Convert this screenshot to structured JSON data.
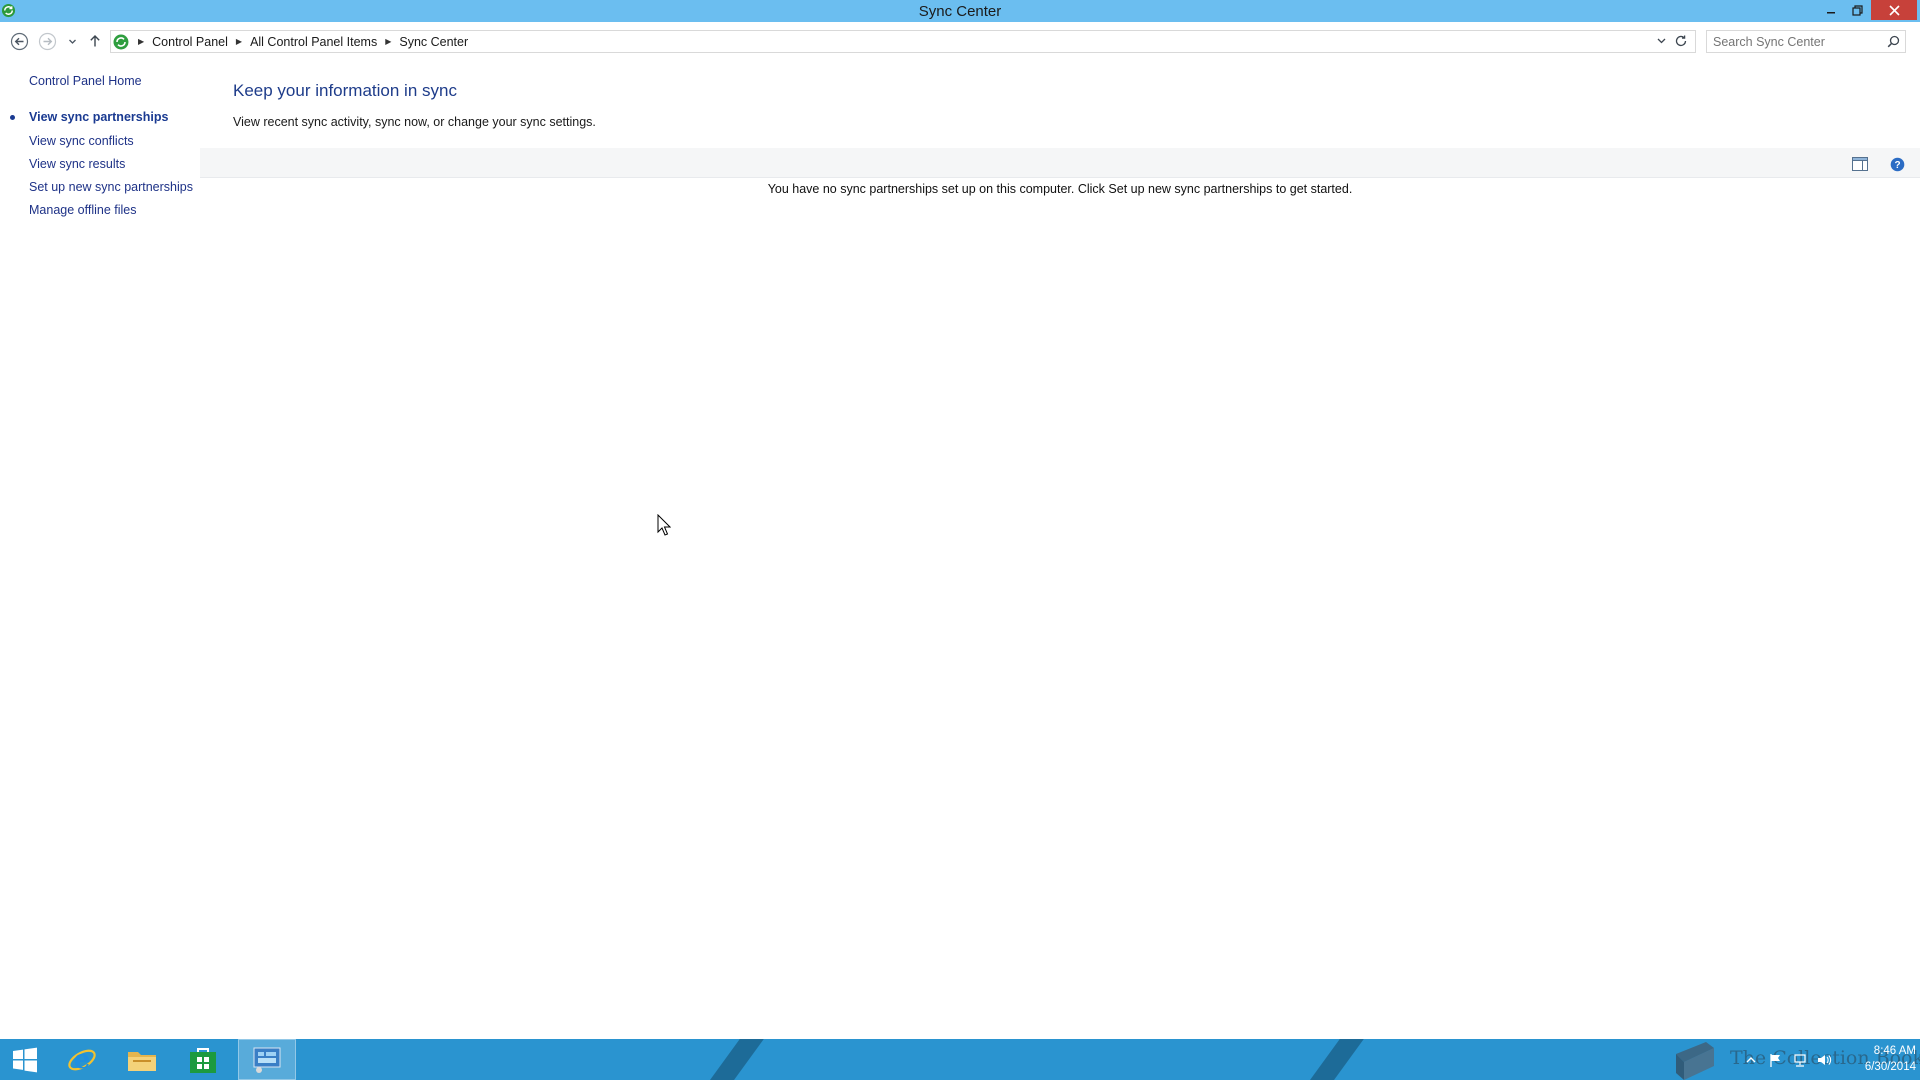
{
  "window": {
    "title": "Sync Center"
  },
  "address_bar": {
    "breadcrumbs": [
      "Control Panel",
      "All Control Panel Items",
      "Sync Center"
    ]
  },
  "search": {
    "placeholder": "Search Sync Center"
  },
  "left_pane": {
    "home": "Control Panel Home",
    "items": [
      {
        "label": "View sync partnerships",
        "selected": true
      },
      {
        "label": "View sync conflicts",
        "selected": false
      },
      {
        "label": "View sync results",
        "selected": false
      },
      {
        "label": "Set up new sync partnerships",
        "selected": false
      },
      {
        "label": "Manage offline files",
        "selected": false
      }
    ]
  },
  "main": {
    "title": "Keep your information in sync",
    "description": "View recent sync activity, sync now, or change your sync settings.",
    "empty_message": "You have no sync partnerships set up on this computer. Click Set up new sync partnerships to get started."
  },
  "taskbar": {
    "time": "8:46 AM",
    "date": "6/30/2014",
    "watermark": "The Collection Book",
    "icons": [
      "windows-start-icon",
      "internet-explorer-icon",
      "file-explorer-icon",
      "store-icon",
      "control-panel-icon"
    ]
  },
  "colors": {
    "title_bar": "#6bbef0",
    "taskbar": "#2a94d0",
    "link": "#1e3287",
    "close_button": "#c7413a"
  }
}
